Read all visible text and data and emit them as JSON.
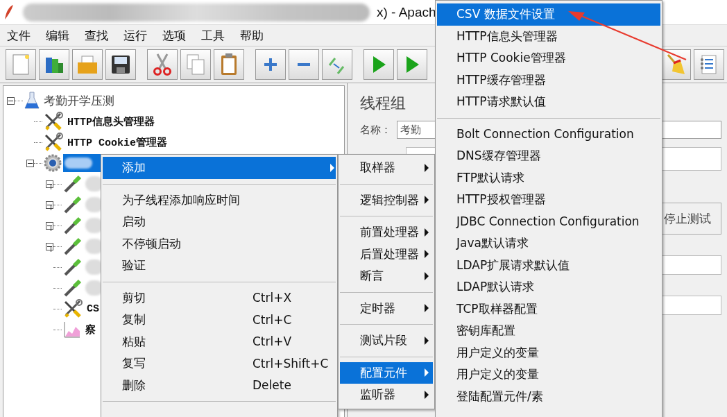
{
  "window": {
    "title_fragment": "x) - Apach"
  },
  "menubar": [
    "文件",
    "编辑",
    "查找",
    "运行",
    "选项",
    "工具",
    "帮助"
  ],
  "tree": {
    "label": "考勤开学压测",
    "kind": "testplan",
    "expanded": true,
    "selected": false,
    "children": [
      {
        "label": "HTTP信息头管理器",
        "kind": "config",
        "selected": false
      },
      {
        "label": "HTTP Cookie管理器",
        "kind": "config",
        "selected": false
      },
      {
        "kind": "threadgroup",
        "expanded": true,
        "selected": true,
        "children": [
          {
            "kind": "sampler",
            "expanded": false
          },
          {
            "kind": "sampler",
            "expanded": false
          },
          {
            "kind": "sampler",
            "expanded": false
          },
          {
            "kind": "sampler",
            "expanded": false
          },
          {
            "kind": "sampler"
          },
          {
            "kind": "sampler"
          },
          {
            "label": "CS",
            "kind": "config",
            "selected": false
          },
          {
            "label": "察",
            "kind": "listener",
            "selected": false
          }
        ]
      }
    ]
  },
  "panel": {
    "title": "线程组",
    "name_label": "名称：",
    "name_value": "考勤",
    "radio_label": "停止测试"
  },
  "context_menu": [
    {
      "kind": "item",
      "label": "添加",
      "submenu": true,
      "selected": true
    },
    {
      "kind": "separator"
    },
    {
      "kind": "item",
      "label": "为子线程添加响应时间",
      "submenu": false,
      "selected": false
    },
    {
      "kind": "item",
      "label": "启动",
      "submenu": false,
      "selected": false
    },
    {
      "kind": "item",
      "label": "不停顿启动",
      "submenu": false,
      "selected": false
    },
    {
      "kind": "item",
      "label": "验证",
      "submenu": false,
      "selected": false
    },
    {
      "kind": "separator"
    },
    {
      "kind": "item",
      "label": "剪切",
      "shortcut": "Ctrl+X",
      "submenu": false,
      "selected": false
    },
    {
      "kind": "item",
      "label": "复制",
      "shortcut": "Ctrl+C",
      "submenu": false,
      "selected": false
    },
    {
      "kind": "item",
      "label": "粘贴",
      "shortcut": "Ctrl+V",
      "submenu": false,
      "selected": false
    },
    {
      "kind": "item",
      "label": "复写",
      "shortcut": "Ctrl+Shift+C",
      "submenu": false,
      "selected": false
    },
    {
      "kind": "item",
      "label": "删除",
      "shortcut": "Delete",
      "submenu": false,
      "selected": false
    },
    {
      "kind": "separator"
    }
  ],
  "add_submenu": [
    {
      "kind": "item",
      "label": "取样器",
      "submenu": true,
      "selected": false
    },
    {
      "kind": "separator"
    },
    {
      "kind": "item",
      "label": "逻辑控制器",
      "submenu": true,
      "selected": false
    },
    {
      "kind": "separator"
    },
    {
      "kind": "item",
      "label": "前置处理器",
      "submenu": true,
      "selected": false
    },
    {
      "kind": "item",
      "label": "后置处理器",
      "submenu": true,
      "selected": false
    },
    {
      "kind": "item",
      "label": "断言",
      "submenu": true,
      "selected": false
    },
    {
      "kind": "separator"
    },
    {
      "kind": "item",
      "label": "定时器",
      "submenu": true,
      "selected": false
    },
    {
      "kind": "separator"
    },
    {
      "kind": "item",
      "label": "测试片段",
      "submenu": true,
      "selected": false
    },
    {
      "kind": "separator"
    },
    {
      "kind": "item",
      "label": "配置元件",
      "submenu": true,
      "selected": true
    },
    {
      "kind": "item",
      "label": "监听器",
      "submenu": true,
      "selected": false
    }
  ],
  "config_submenu": [
    {
      "kind": "item",
      "label": "CSV 数据文件设置",
      "submenu": false,
      "selected": true
    },
    {
      "kind": "item",
      "label": "HTTP信息头管理器",
      "submenu": false,
      "selected": false
    },
    {
      "kind": "item",
      "label": "HTTP Cookie管理器",
      "submenu": false,
      "selected": false
    },
    {
      "kind": "item",
      "label": "HTTP缓存管理器",
      "submenu": false,
      "selected": false
    },
    {
      "kind": "item",
      "label": "HTTP请求默认值",
      "submenu": false,
      "selected": false
    },
    {
      "kind": "separator"
    },
    {
      "kind": "item",
      "label": "Bolt Connection Configuration",
      "submenu": false,
      "selected": false
    },
    {
      "kind": "item",
      "label": "DNS缓存管理器",
      "submenu": false,
      "selected": false
    },
    {
      "kind": "item",
      "label": "FTP默认请求",
      "submenu": false,
      "selected": false
    },
    {
      "kind": "item",
      "label": "HTTP授权管理器",
      "submenu": false,
      "selected": false
    },
    {
      "kind": "item",
      "label": "JDBC Connection Configuration",
      "submenu": false,
      "selected": false
    },
    {
      "kind": "item",
      "label": "Java默认请求",
      "submenu": false,
      "selected": false
    },
    {
      "kind": "item",
      "label": "LDAP扩展请求默认值",
      "submenu": false,
      "selected": false
    },
    {
      "kind": "item",
      "label": "LDAP默认请求",
      "submenu": false,
      "selected": false
    },
    {
      "kind": "item",
      "label": "TCP取样器配置",
      "submenu": false,
      "selected": false
    },
    {
      "kind": "item",
      "label": "密钥库配置",
      "submenu": false,
      "selected": false
    },
    {
      "kind": "item",
      "label": "用户定义的变量",
      "submenu": false,
      "selected": false
    },
    {
      "kind": "item",
      "label": "用户定义的变量",
      "submenu": false,
      "selected": false
    },
    {
      "kind": "item",
      "label": "登陆配置元件/素",
      "submenu": false,
      "selected": false
    }
  ]
}
